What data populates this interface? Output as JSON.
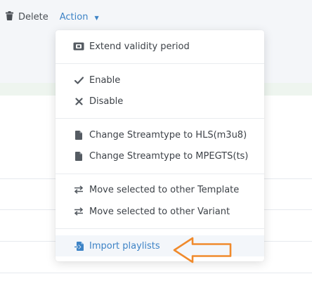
{
  "toolbar": {
    "delete_label": "Delete",
    "action_label": "Action"
  },
  "menu": {
    "extend": "Extend validity period",
    "enable": "Enable",
    "disable": "Disable",
    "hls": "Change Streamtype to HLS(m3u8)",
    "mpegts": "Change Streamtype to MPEGTS(ts)",
    "move_template": "Move selected to other Template",
    "move_variant": "Move selected to other Variant",
    "import": "Import playlists"
  },
  "colors": {
    "accent": "#3d83c6",
    "annotation_arrow": "#f08a2c"
  },
  "icons": {
    "delete": "trash-icon",
    "extend": "ticket-icon",
    "enable": "check-icon",
    "disable": "x-icon",
    "hls": "file-icon",
    "mpegts": "file-icon",
    "move_template": "exchange-icon",
    "move_variant": "exchange-icon",
    "import": "file-import-icon"
  }
}
